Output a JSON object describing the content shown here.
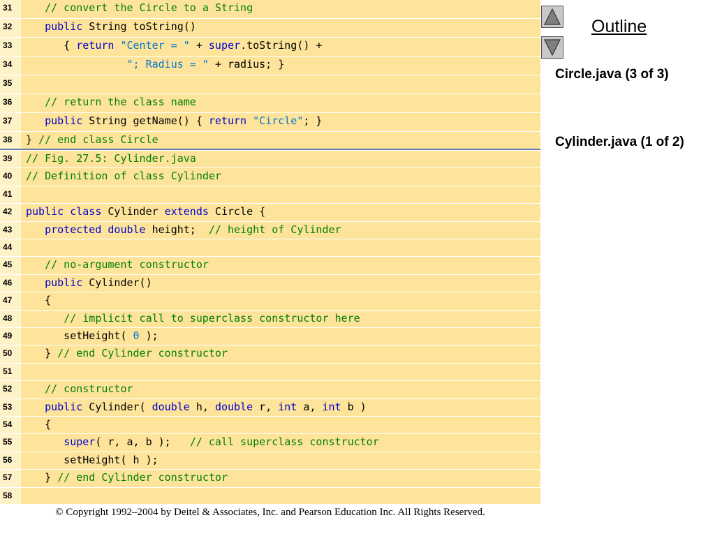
{
  "code": {
    "lines": [
      {
        "num": "31",
        "tokens": [
          {
            "t": "   "
          },
          {
            "t": "// convert the Circle to a String",
            "c": "c"
          }
        ]
      },
      {
        "num": "32",
        "tokens": [
          {
            "t": "   "
          },
          {
            "t": "public",
            "c": "k"
          },
          {
            "t": " String toString()"
          }
        ]
      },
      {
        "num": "33",
        "tokens": [
          {
            "t": "      { "
          },
          {
            "t": "return",
            "c": "k"
          },
          {
            "t": " "
          },
          {
            "t": "\"Center = \"",
            "c": "s"
          },
          {
            "t": " + "
          },
          {
            "t": "super",
            "c": "k"
          },
          {
            "t": ".toString() +"
          }
        ]
      },
      {
        "num": "34",
        "tokens": [
          {
            "t": "                "
          },
          {
            "t": "\"; Radius = \"",
            "c": "s"
          },
          {
            "t": " + radius; }"
          }
        ]
      },
      {
        "num": "35",
        "tokens": []
      },
      {
        "num": "36",
        "tokens": [
          {
            "t": "   "
          },
          {
            "t": "// return the class name",
            "c": "c"
          }
        ]
      },
      {
        "num": "37",
        "tokens": [
          {
            "t": "   "
          },
          {
            "t": "public",
            "c": "k"
          },
          {
            "t": " String getName() { "
          },
          {
            "t": "return",
            "c": "k"
          },
          {
            "t": " "
          },
          {
            "t": "\"Circle\"",
            "c": "s"
          },
          {
            "t": "; }"
          }
        ]
      },
      {
        "num": "38",
        "tokens": [
          {
            "t": "} "
          },
          {
            "t": "// end class Circle",
            "c": "c"
          }
        ]
      },
      {
        "num": "39",
        "tokens": [
          {
            "t": "// Fig. 27.5: Cylinder.java",
            "c": "c"
          }
        ]
      },
      {
        "num": "40",
        "tokens": [
          {
            "t": "// Definition of class Cylinder",
            "c": "c"
          }
        ]
      },
      {
        "num": "41",
        "tokens": []
      },
      {
        "num": "42",
        "tokens": [
          {
            "t": "public",
            "c": "k"
          },
          {
            "t": " "
          },
          {
            "t": "class",
            "c": "k"
          },
          {
            "t": " Cylinder "
          },
          {
            "t": "extends",
            "c": "k"
          },
          {
            "t": " Circle {"
          }
        ]
      },
      {
        "num": "43",
        "tokens": [
          {
            "t": "   "
          },
          {
            "t": "protected",
            "c": "k"
          },
          {
            "t": " "
          },
          {
            "t": "double",
            "c": "k"
          },
          {
            "t": " height;  "
          },
          {
            "t": "// height of Cylinder",
            "c": "c"
          }
        ]
      },
      {
        "num": "44",
        "tokens": []
      },
      {
        "num": "45",
        "tokens": [
          {
            "t": "   "
          },
          {
            "t": "// no-argument constructor",
            "c": "c"
          }
        ]
      },
      {
        "num": "46",
        "tokens": [
          {
            "t": "   "
          },
          {
            "t": "public",
            "c": "k"
          },
          {
            "t": " Cylinder()"
          }
        ]
      },
      {
        "num": "47",
        "tokens": [
          {
            "t": "   {"
          }
        ]
      },
      {
        "num": "48",
        "tokens": [
          {
            "t": "      "
          },
          {
            "t": "// implicit call to superclass constructor here",
            "c": "c"
          }
        ]
      },
      {
        "num": "49",
        "tokens": [
          {
            "t": "      setHeight( "
          },
          {
            "t": "0",
            "c": "n"
          },
          {
            "t": " );"
          }
        ]
      },
      {
        "num": "50",
        "tokens": [
          {
            "t": "   } "
          },
          {
            "t": "// end Cylinder constructor",
            "c": "c"
          }
        ]
      },
      {
        "num": "51",
        "tokens": []
      },
      {
        "num": "52",
        "tokens": [
          {
            "t": "   "
          },
          {
            "t": "// constructor",
            "c": "c"
          }
        ]
      },
      {
        "num": "53",
        "tokens": [
          {
            "t": "   "
          },
          {
            "t": "public",
            "c": "k"
          },
          {
            "t": " Cylinder( "
          },
          {
            "t": "double",
            "c": "k"
          },
          {
            "t": " h, "
          },
          {
            "t": "double",
            "c": "k"
          },
          {
            "t": " r, "
          },
          {
            "t": "int",
            "c": "k"
          },
          {
            "t": " a, "
          },
          {
            "t": "int",
            "c": "k"
          },
          {
            "t": " b )"
          }
        ]
      },
      {
        "num": "54",
        "tokens": [
          {
            "t": "   {"
          }
        ]
      },
      {
        "num": "55",
        "tokens": [
          {
            "t": "      "
          },
          {
            "t": "super",
            "c": "k"
          },
          {
            "t": "( r, a, b );   "
          },
          {
            "t": "// call superclass constructor",
            "c": "c"
          }
        ]
      },
      {
        "num": "56",
        "tokens": [
          {
            "t": "      setHeight( h );"
          }
        ]
      },
      {
        "num": "57",
        "tokens": [
          {
            "t": "   } "
          },
          {
            "t": "// end Cylinder constructor",
            "c": "c"
          }
        ]
      },
      {
        "num": "58",
        "tokens": []
      }
    ]
  },
  "copyright": "© Copyright 1992–2004 by Deitel & Associates, Inc. and Pearson Education Inc. All Rights Reserved.",
  "outline": {
    "title": "Outline",
    "items": [
      "Circle.java (3 of 3)",
      "Cylinder.java (1 of 2)"
    ]
  },
  "nav": {
    "prev_icon": "triangle-up-icon",
    "next_icon": "triangle-down-icon"
  },
  "colors": {
    "code_background": "#fde49a",
    "keyword": "#0000cc",
    "comment": "#008000",
    "string": "#0077cc"
  }
}
